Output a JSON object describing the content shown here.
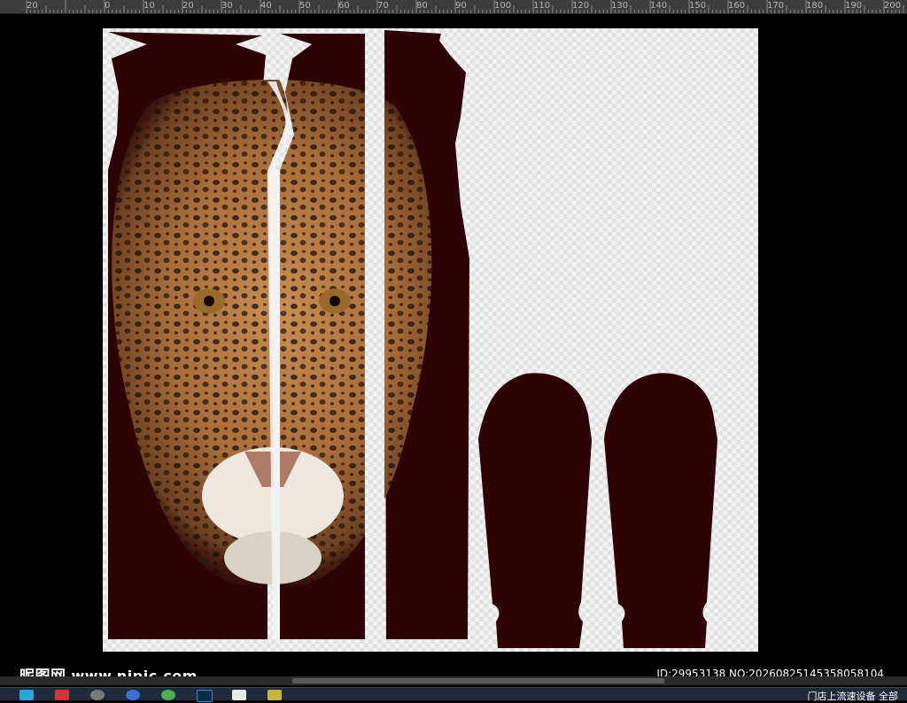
{
  "ruler": {
    "labels": [
      "20",
      "0",
      "10",
      "20",
      "30",
      "40",
      "50",
      "60",
      "70",
      "80",
      "90",
      "100",
      "110",
      "120",
      "130",
      "140",
      "150",
      "160",
      "170",
      "180",
      "190",
      "200"
    ]
  },
  "document": {
    "background_color": "#f2f2f2",
    "fabric_color": "#2e0306",
    "panels": [
      "front-left-panel",
      "front-right-panel",
      "back-panel",
      "left-sleeve",
      "right-sleeve"
    ]
  },
  "watermark": {
    "logo_text": "昵图网",
    "site_text": "www.nipic.com",
    "id_text": "ID:29953138 NO:20260825145358058104"
  },
  "taskbar": {
    "icons": [
      "start-icon",
      "app-icon-1",
      "app-icon-2",
      "app-icon-3",
      "app-icon-4",
      "photoshop-icon",
      "app-icon-5",
      "app-icon-6"
    ],
    "tray_text": "门店上流速设备 全部"
  },
  "colors": {
    "ruler_bg": "#3c3c3c",
    "canvas_bg": "#000000",
    "taskbar_bg": "#1f2a3a"
  }
}
